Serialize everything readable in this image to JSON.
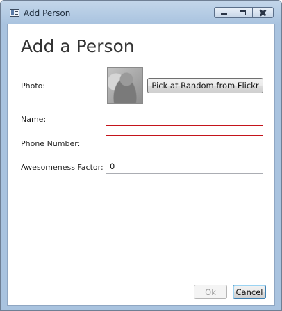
{
  "window": {
    "title": "Add Person",
    "icons": {
      "app": "window-icon",
      "minimize": "minimize-icon",
      "maximize": "maximize-icon",
      "close": "close-icon"
    }
  },
  "form": {
    "heading": "Add a Person",
    "photo_label": "Photo:",
    "photo_button": "Pick at Random from Flickr",
    "name_label": "Name:",
    "name_value": "",
    "phone_label": "Phone Number:",
    "phone_value": "",
    "awesomeness_label": "Awesomeness Factor:",
    "awesomeness_value": "0"
  },
  "validation": {
    "invalid_border_color": "#c4151c"
  },
  "actions": {
    "ok": "Ok",
    "ok_enabled": false,
    "cancel": "Cancel"
  }
}
